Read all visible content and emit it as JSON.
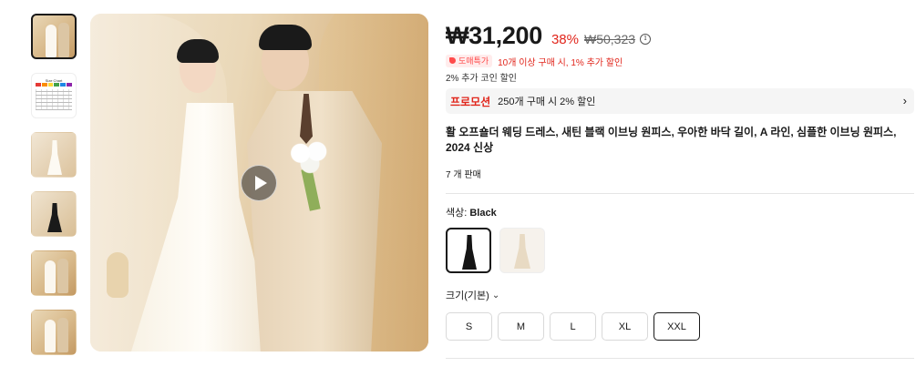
{
  "gallery": {
    "thumbnails": [
      {
        "kind": "photo",
        "active": true
      },
      {
        "kind": "size-chart",
        "chart_title": "Size Chart",
        "swatch_colors": [
          "#e53935",
          "#fb8c00",
          "#fdd835",
          "#43a047",
          "#1e88e5",
          "#8e24aa"
        ]
      },
      {
        "kind": "white-dress",
        "active": false
      },
      {
        "kind": "black-dress",
        "active": false
      },
      {
        "kind": "photo",
        "active": false
      },
      {
        "kind": "photo",
        "active": false
      }
    ],
    "main_image": {
      "has_video": true,
      "play_icon": "play-icon"
    }
  },
  "product": {
    "price": "₩31,200",
    "discount": "38%",
    "original_price": "₩50,323",
    "deal_badge": "도매특가",
    "deal_text": "10개 이상 구매 시, 1% 추가 할인",
    "coin_text": "2% 추가 코인 할인",
    "promo_label": "프로모션",
    "promo_text": "250개 구매 시 2% 할인",
    "title": "활 오프숄더 웨딩 드레스, 새틴 블랙 이브닝 원피스, 우아한 바닥 길이, A 라인, 심플한 이브닝 원피스, 2024 신상",
    "sold": "7 개 판매",
    "color_label": "색상: ",
    "color_value": "Black",
    "colors": [
      {
        "name": "Black",
        "selected": true
      },
      {
        "name": "Ivory",
        "selected": false
      }
    ],
    "size_label": "크기(기본)",
    "sizes": [
      {
        "label": "S",
        "selected": false
      },
      {
        "label": "M",
        "selected": false
      },
      {
        "label": "L",
        "selected": false
      },
      {
        "label": "XL",
        "selected": false
      },
      {
        "label": "XXL",
        "selected": true
      }
    ]
  },
  "colors": {
    "accent_red": "#e1251b",
    "text": "#191919",
    "promo_bg": "#f5f5f5"
  }
}
